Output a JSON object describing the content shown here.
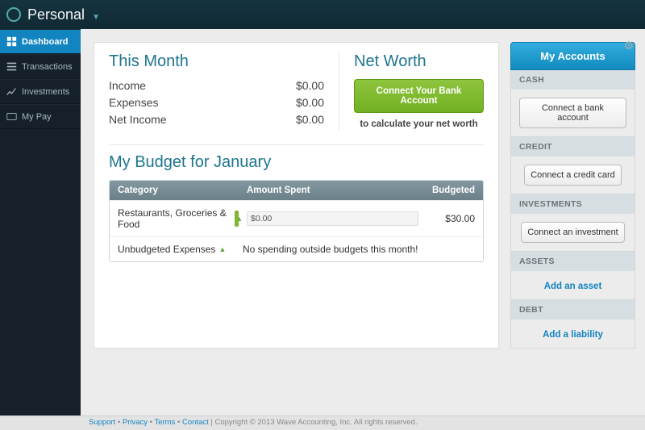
{
  "topbar": {
    "title": "Personal"
  },
  "sidebar": {
    "items": [
      {
        "label": "Dashboard"
      },
      {
        "label": "Transactions"
      },
      {
        "label": "Investments"
      },
      {
        "label": "My Pay"
      }
    ]
  },
  "thisMonth": {
    "title": "This Month",
    "rows": [
      {
        "label": "Income",
        "value": "$0.00"
      },
      {
        "label": "Expenses",
        "value": "$0.00"
      },
      {
        "label": "Net Income",
        "value": "$0.00"
      }
    ]
  },
  "netWorth": {
    "title": "Net Worth",
    "cta": "Connect Your Bank Account",
    "sub": "to calculate your net worth"
  },
  "budget": {
    "title": "My Budget for January",
    "headers": {
      "c1": "Category",
      "c2": "Amount Spent",
      "c3": "Budgeted"
    },
    "rows": [
      {
        "category": "Restaurants, Groceries & Food",
        "spent": "$0.00",
        "budgeted": "$30.00"
      }
    ],
    "unbudgeted": {
      "label": "Unbudgeted Expenses",
      "msg": "No spending outside budgets this month!"
    }
  },
  "accounts": {
    "title": "My Accounts",
    "sections": [
      {
        "label": "CASH",
        "action": "Connect a bank account",
        "btn": true
      },
      {
        "label": "CREDIT",
        "action": "Connect a credit card",
        "btn": true
      },
      {
        "label": "INVESTMENTS",
        "action": "Connect an investment",
        "btn": true
      },
      {
        "label": "ASSETS",
        "action": "Add an asset",
        "btn": false
      },
      {
        "label": "DEBT",
        "action": "Add a liability",
        "btn": false
      }
    ]
  },
  "footer": {
    "links": [
      "Support",
      "Privacy",
      "Terms",
      "Contact"
    ],
    "copy": " | Copyright © 2013 Wave Accounting, Inc. All rights reserved."
  }
}
